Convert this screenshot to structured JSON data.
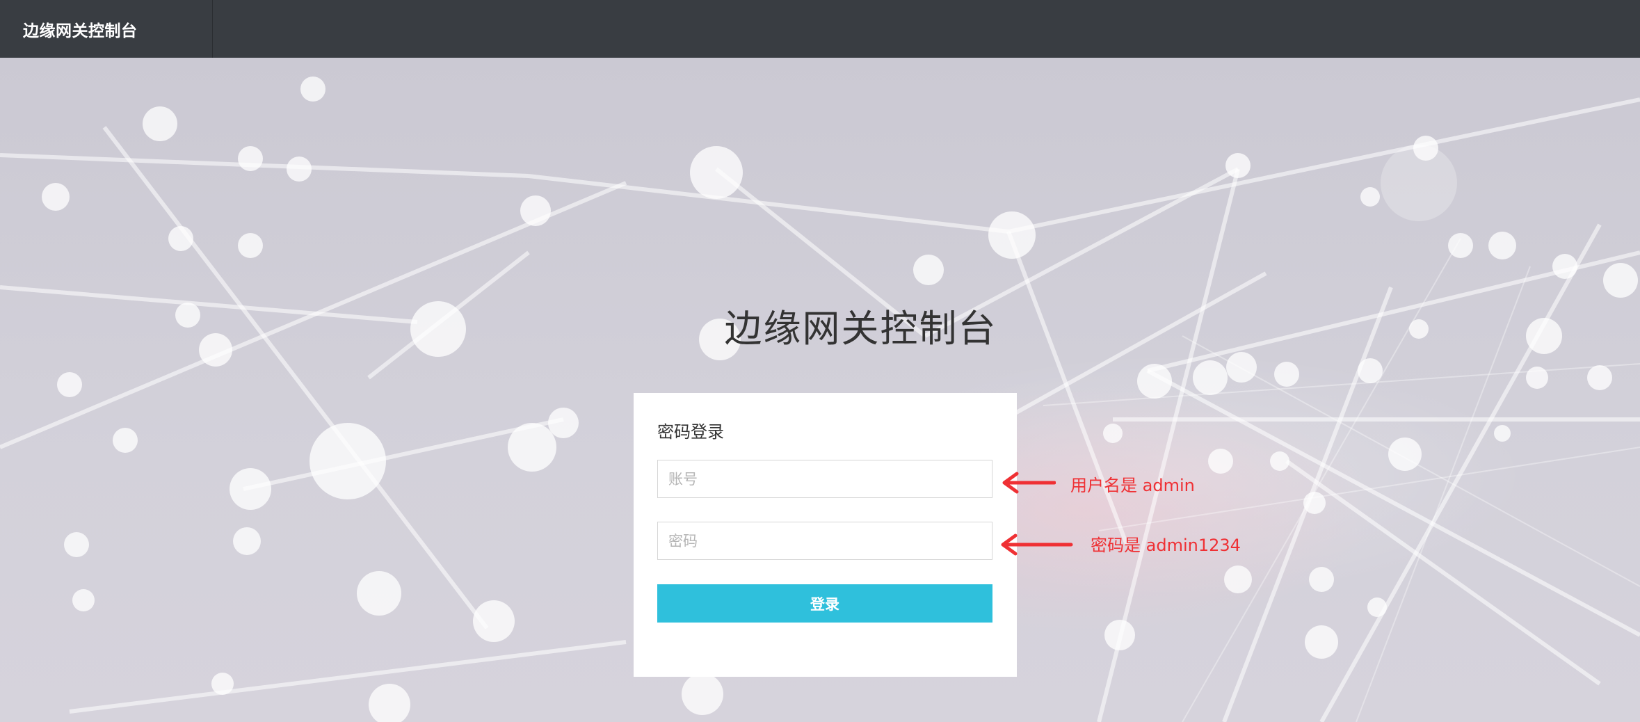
{
  "header": {
    "brand": "边缘网关控制台"
  },
  "page": {
    "title": "边缘网关控制台"
  },
  "login": {
    "card_title": "密码登录",
    "username_placeholder": "账号",
    "password_placeholder": "密码",
    "submit_label": "登录"
  },
  "annotations": {
    "username_hint": "用户名是 admin",
    "password_hint": "密码是 admin1234",
    "color": "#ef3034"
  },
  "colors": {
    "topbar": "#393d42",
    "accent_button": "#2fc0dc"
  }
}
